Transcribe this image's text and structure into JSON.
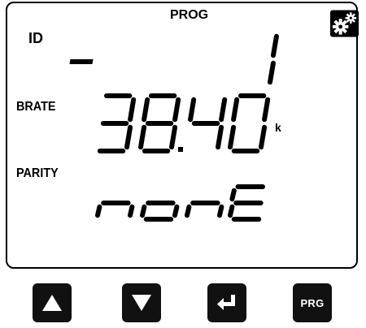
{
  "display": {
    "mode": "PROG",
    "settings_icon": "gears-icon",
    "rows": [
      {
        "label": "ID",
        "value": "-1"
      },
      {
        "label": "BRATE",
        "value": "38.40",
        "unit": "k"
      },
      {
        "label": "PARITY",
        "value": "nonE"
      }
    ]
  },
  "buttons": {
    "up_icon": "triangle-up-icon",
    "down_icon": "triangle-down-icon",
    "enter_icon": "enter-arrow-icon",
    "prg_label": "PRG"
  },
  "colors": {
    "segment": "#000000",
    "button_bg": "#111111",
    "button_fg": "#ffffff"
  }
}
